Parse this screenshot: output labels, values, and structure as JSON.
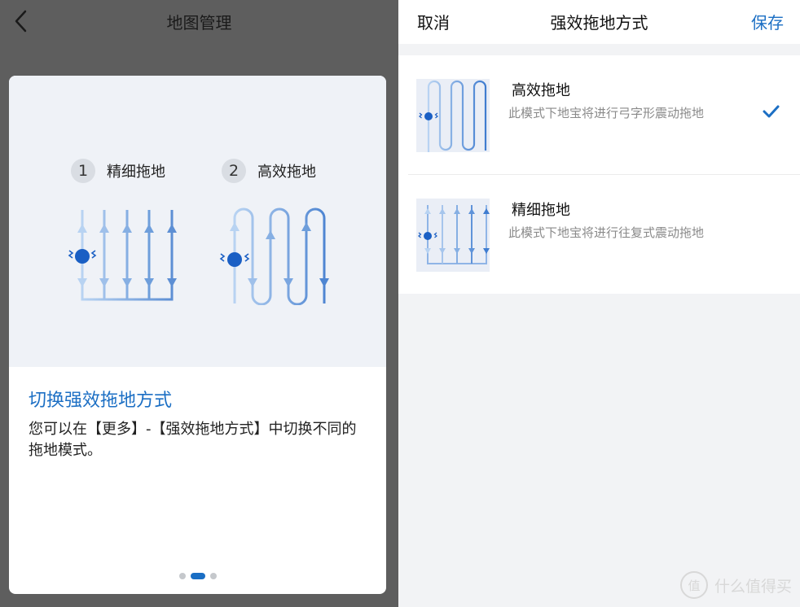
{
  "left_screen": {
    "header": {
      "title": "地图管理",
      "back_icon": "chevron-left-icon"
    },
    "card": {
      "modes": [
        {
          "number": "1",
          "label": "精细拖地"
        },
        {
          "number": "2",
          "label": "高效拖地"
        }
      ],
      "title": "切换强效拖地方式",
      "description": "您可以在【更多】-【强效拖地方式】中切换不同的拖地模式。",
      "pagination": {
        "pages": 3,
        "active_index": 1
      }
    }
  },
  "right_screen": {
    "header": {
      "cancel_label": "取消",
      "title": "强效拖地方式",
      "save_label": "保存"
    },
    "options": [
      {
        "title": "高效拖地",
        "description": "此模式下地宝将进行弓字形震动拖地",
        "selected": true,
        "icon": "zigzag-mop-path-icon"
      },
      {
        "title": "精细拖地",
        "description": "此模式下地宝将进行往复式震动拖地",
        "selected": false,
        "icon": "parallel-mop-path-icon"
      }
    ]
  },
  "watermark": {
    "icon_text": "值",
    "text": "什么值得买"
  },
  "colors": {
    "accent": "#1c6fc4",
    "dim_overlay": "#5e5e5e",
    "illustration_bg": "#eff2f7",
    "page_bg": "#f2f3f5"
  }
}
